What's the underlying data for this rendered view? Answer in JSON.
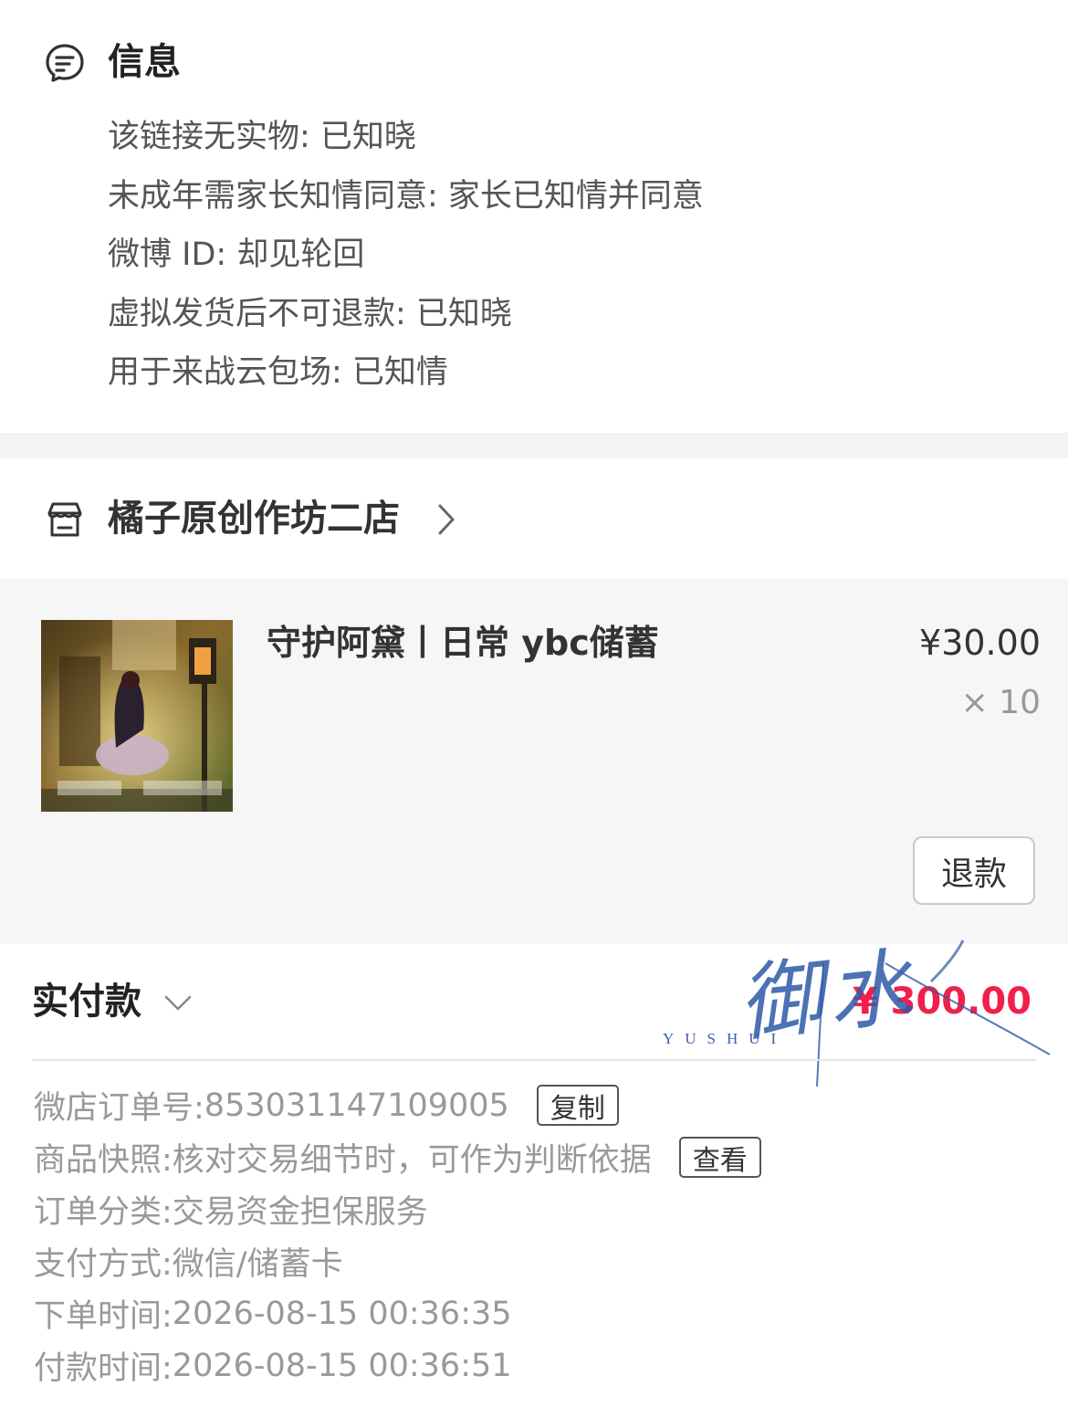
{
  "info": {
    "title": "信息",
    "icon": "message-icon",
    "lines": [
      "该链接无实物: 已知晓",
      "未成年需家长知情同意: 家长已知情并同意",
      "微博 ID: 却见轮回",
      "虚拟发货后不可退款: 已知晓",
      "用于来战云包场: 已知情"
    ]
  },
  "shop": {
    "icon": "store-icon",
    "name": "橘子原创作坊二店"
  },
  "product": {
    "title": "守护阿黛丨日常 ybc储蓄",
    "price": "¥30.00",
    "quantity": "× 10",
    "refund_label": "退款"
  },
  "payment": {
    "label": "实付款",
    "amount": "¥ 300.00"
  },
  "watermark": {
    "script_text": "御水",
    "sub_text": "YUSHUI"
  },
  "details": [
    {
      "label": "微店订单号: ",
      "value": "853031147109005",
      "button": "复制"
    },
    {
      "label": "商品快照: ",
      "value": "核对交易细节时，可作为判断依据",
      "button": "查看"
    },
    {
      "label": "订单分类: ",
      "value": "交易资金担保服务"
    },
    {
      "label": "支付方式: ",
      "value": "微信/储蓄卡"
    },
    {
      "label": "下单时间: ",
      "value": "2026-08-15 00:36:35"
    },
    {
      "label": "付款时间: ",
      "value": "2026-08-15 00:36:51"
    }
  ],
  "colors": {
    "accent_red": "#f0204a",
    "watermark_blue": "#2d5aa8",
    "panel_gray": "#f6f6f6"
  }
}
